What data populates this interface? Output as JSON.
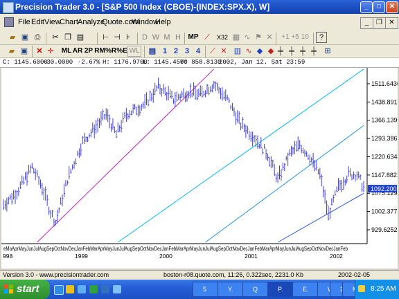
{
  "window": {
    "title": "Precision Trader 3.0 - [S&P 500 Index (CBOE)-(INDEX:SPX.X), W]",
    "min_label": "_",
    "max_label": "□",
    "close_label": "✕",
    "mdi_min": "_",
    "mdi_restore": "❐",
    "mdi_close": "✕"
  },
  "menu": [
    "File",
    "Edit",
    "View",
    "Chart",
    "Analyze",
    "Quote.com",
    "Window",
    "Help"
  ],
  "toolbar1": {
    "period_buttons": [
      "D",
      "W",
      "M",
      "H"
    ],
    "mp_label": "MP",
    "x32_label": "X32",
    "zoom_label": "+1 +5 10"
  },
  "toolbar2": {
    "buttons": [
      "ML",
      "AR",
      "2P",
      "RM",
      "%R",
      "%E",
      "WL"
    ],
    "numbers": [
      "1",
      "2",
      "3",
      "4"
    ]
  },
  "quote": {
    "close": "C: 1145.6000",
    "change": "-30.0000",
    "pct": "-2.67%",
    "high": "H: 1176.9700",
    "low": "L: 1145.4500",
    "cursor_y": "Y: 858.8130",
    "datetime": "2002, Jan 12. Sat  23:59"
  },
  "chart_data": {
    "type": "ohlc-weekly",
    "y_ticks": [
      "1511.6436",
      "1438.8913",
      "1366.1390",
      "1293.3867",
      "1220.6344",
      "1147.8821",
      "1075.1298",
      "1002.3775",
      "929.6252"
    ],
    "y_ticks_values": [
      1511.6436,
      1438.8913,
      1366.139,
      1293.3867,
      1220.6344,
      1147.8821,
      1075.1298,
      1002.3775,
      929.6252
    ],
    "ylim": [
      880,
      1575
    ],
    "last_price_label": "1092.200",
    "last_price": 1092.2,
    "x_month_labels": "eMaAprMayJunJulAugSepOctNovDecJanFebMarAprMayJunJulAugSepOctNovDecJanFebMarAprMayJunJulAugSepOctNovDecJanFebMarAprMayJunJulAugSepOctNovDecJanFeb",
    "x_years": [
      "998",
      "1999",
      "2000",
      "2001",
      "2002"
    ],
    "anchors": [
      {
        "week": 0,
        "value": 1030
      },
      {
        "week": 8,
        "value": 1080
      },
      {
        "week": 17,
        "value": 1180
      },
      {
        "week": 23,
        "value": 1100
      },
      {
        "week": 28,
        "value": 1000
      },
      {
        "week": 31,
        "value": 960
      },
      {
        "week": 38,
        "value": 1130
      },
      {
        "week": 47,
        "value": 1280
      },
      {
        "week": 55,
        "value": 1340
      },
      {
        "week": 61,
        "value": 1390
      },
      {
        "week": 67,
        "value": 1310
      },
      {
        "week": 73,
        "value": 1390
      },
      {
        "week": 84,
        "value": 1430
      },
      {
        "week": 92,
        "value": 1500
      },
      {
        "week": 101,
        "value": 1450
      },
      {
        "week": 110,
        "value": 1480
      },
      {
        "week": 117,
        "value": 1470
      },
      {
        "week": 125,
        "value": 1510
      },
      {
        "week": 133,
        "value": 1450
      },
      {
        "week": 141,
        "value": 1350
      },
      {
        "week": 149,
        "value": 1300
      },
      {
        "week": 157,
        "value": 1230
      },
      {
        "week": 163,
        "value": 1130
      },
      {
        "week": 170,
        "value": 1230
      },
      {
        "week": 176,
        "value": 1270
      },
      {
        "week": 182,
        "value": 1220
      },
      {
        "week": 188,
        "value": 1150
      },
      {
        "week": 193,
        "value": 990
      },
      {
        "week": 199,
        "value": 1100
      },
      {
        "week": 205,
        "value": 1150
      },
      {
        "week": 210,
        "value": 1150
      },
      {
        "week": 214,
        "value": 1100
      }
    ],
    "trend_lines": [
      {
        "color": "#c020c0",
        "p1": [
          20,
          880
        ],
        "p2": [
          125,
          1570
        ]
      },
      {
        "color": "#00b8f0",
        "p1": [
          68,
          880
        ],
        "p2": [
          214,
          1570
        ]
      },
      {
        "color": "#2090e8",
        "p1": [
          120,
          880
        ],
        "p2": [
          214,
          1345
        ]
      },
      {
        "color": "#2050d8",
        "p1": [
          163,
          880
        ],
        "p2": [
          214,
          1075
        ]
      }
    ],
    "bar_color": "#4040e0"
  },
  "status": {
    "version": "Version 3.0 - www.precisiontrader.com",
    "server": "boston-r08.quote.com, 11:26, 0.322sec, 2231.0 Kb",
    "date": "2002-02-05"
  },
  "taskbar": {
    "start_label": "start",
    "tasks": [
      "5",
      "Y.",
      "Q",
      "P.",
      "E.",
      "W",
      "2",
      "M"
    ],
    "clock": "8:25 AM"
  }
}
